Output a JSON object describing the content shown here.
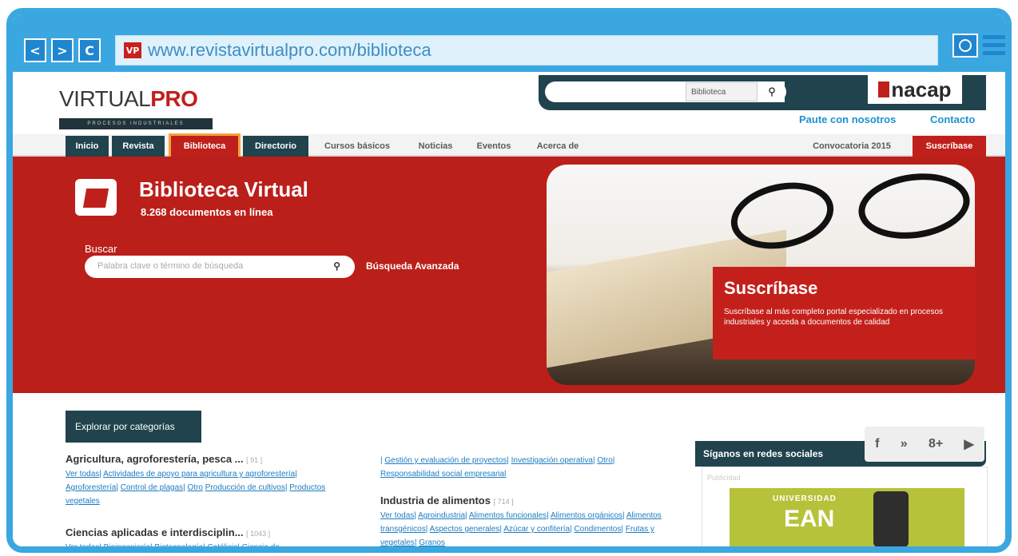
{
  "browser": {
    "back": "<",
    "forward": ">",
    "reload": "C",
    "favicon": "VP",
    "url": "www.revistavirtualpro.com/biblioteca"
  },
  "header": {
    "logo_prefix": "VIRTUAL",
    "logo_accent": "PRO",
    "tagline": "PROCESOS INDUSTRIALES",
    "search_select": "Biblioteca",
    "nacap": "nacap",
    "links": [
      "Paute con nosotros",
      "Contacto"
    ]
  },
  "tabs": [
    "Inicio",
    "Revista",
    "Biblioteca",
    "Directorio",
    "Cursos básicos",
    "Noticias",
    "Eventos",
    "Acerca de",
    "Convocatoria 2015",
    "Suscríbase"
  ],
  "hero": {
    "title": "Biblioteca Virtual",
    "count": "8.268 documentos en línea",
    "search_label": "Buscar",
    "search_placeholder": "Palabra clave o término de búsqueda",
    "advanced": "Búsqueda Avanzada",
    "promo_title": "Suscríbase",
    "promo_text": "Suscríbase al más completo portal especializado en procesos industriales y acceda a documentos de calidad"
  },
  "categories": {
    "explore": "Explorar por categorías",
    "col1": [
      {
        "title": "Agricultura, agroforestería, pesca ...",
        "count": "[ 91 ]",
        "links": [
          "Ver todas",
          "Actividades de apoyo para agricultura y agroforestería",
          "Agroforestería",
          "Control de plagas",
          "Otro",
          "Producción de cultivos",
          "Productos vegetales"
        ]
      },
      {
        "title": "Ciencias aplicadas e interdisciplin...",
        "count": "[ 1043 ]",
        "links": [
          "Ver todas",
          "Bioingeniería",
          "Biotecnología",
          "Catálisis",
          "Ciencia de"
        ]
      }
    ],
    "col2_top": [
      "Gestión y evaluación de proyectos",
      "Investigación operativa",
      "Otro",
      "Responsabilidad social empresarial"
    ],
    "col2": {
      "title": "Industria de alimentos",
      "count": "[ 714 ]",
      "links": [
        "Ver todas",
        "Agroindustria",
        "Alimentos funcionales",
        "Alimentos orgánicos",
        "Alimentos transgénicos",
        "Aspectos generales",
        "Azúcar y confitería",
        "Condimentos",
        "Frutas y vegetales",
        "Granos"
      ]
    }
  },
  "social": {
    "title": "Síganos en redes sociales",
    "icons": [
      "f",
      "»",
      "8+",
      "▶"
    ],
    "pub": "Publicidad",
    "ean_1": "UNIVERSIDAD",
    "ean_2": "EAN"
  }
}
